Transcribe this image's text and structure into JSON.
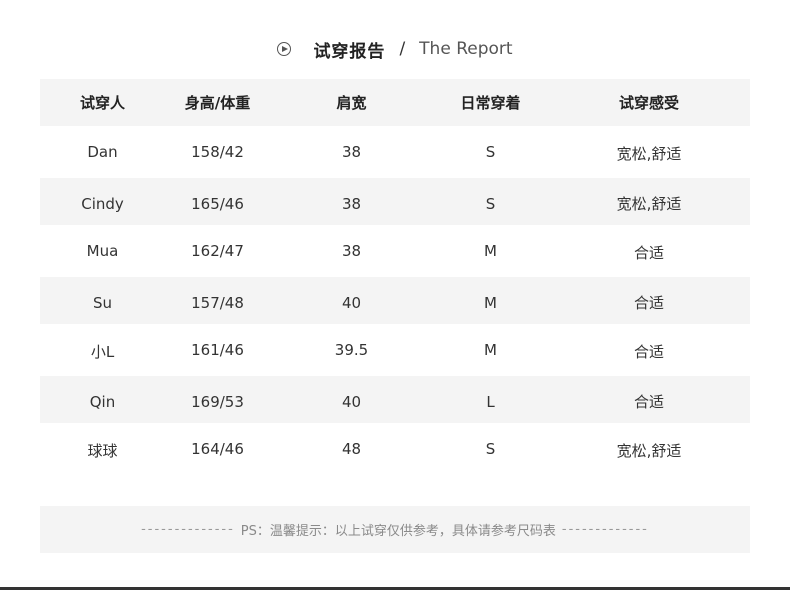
{
  "title": {
    "cn": "试穿报告",
    "sep": "/",
    "en": "The Report"
  },
  "headers": [
    "试穿人",
    "身高/体重",
    "肩宽",
    "日常穿着",
    "试穿感受"
  ],
  "rows": [
    [
      "Dan",
      "158/42",
      "38",
      "S",
      "宽松,舒适"
    ],
    [
      "Cindy",
      "165/46",
      "38",
      "S",
      "宽松,舒适"
    ],
    [
      "Mua",
      "162/47",
      "38",
      "M",
      "合适"
    ],
    [
      "Su",
      "157/48",
      "40",
      "M",
      "合适"
    ],
    [
      "小L",
      "161/46",
      "39.5",
      "M",
      "合适"
    ],
    [
      "Qin",
      "169/53",
      "40",
      "L",
      "合适"
    ],
    [
      "球球",
      "164/46",
      "48",
      "S",
      "宽松,舒适"
    ]
  ],
  "ps": {
    "dashes_left": "--------------",
    "text": "PS：温馨提示：以上试穿仅供参考，具体请参考尺码表",
    "dashes_right": "-------------"
  }
}
